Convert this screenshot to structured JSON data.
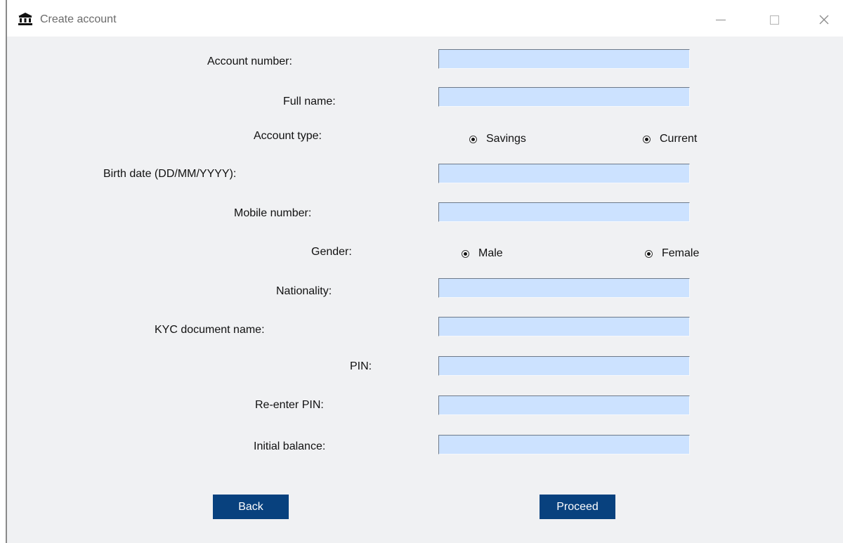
{
  "window": {
    "title": "Create account",
    "icon": "bank-icon",
    "controls": [
      "minimize-icon",
      "maximize-icon",
      "close-icon"
    ]
  },
  "form": {
    "account_number": {
      "label": "Account number:",
      "value": ""
    },
    "full_name": {
      "label": "Full name:",
      "value": ""
    },
    "account_type": {
      "label": "Account type:",
      "options": [
        "Savings",
        "Current"
      ]
    },
    "birth_date": {
      "label": "Birth date (DD/MM/YYYY):",
      "value": ""
    },
    "mobile_number": {
      "label": "Mobile number:",
      "value": ""
    },
    "gender": {
      "label": "Gender:",
      "options": [
        "Male",
        "Female"
      ]
    },
    "nationality": {
      "label": "Nationality:",
      "value": ""
    },
    "kyc_document": {
      "label": "KYC document name:",
      "value": ""
    },
    "pin": {
      "label": "PIN:",
      "value": ""
    },
    "reenter_pin": {
      "label": "Re-enter PIN:",
      "value": ""
    },
    "initial_balance": {
      "label": "Initial balance:",
      "value": ""
    }
  },
  "buttons": {
    "back": "Back",
    "proceed": "Proceed"
  },
  "colors": {
    "field_bg": "#cce2ff",
    "button_bg": "#08417e",
    "window_bg": "#f0f1f3"
  }
}
